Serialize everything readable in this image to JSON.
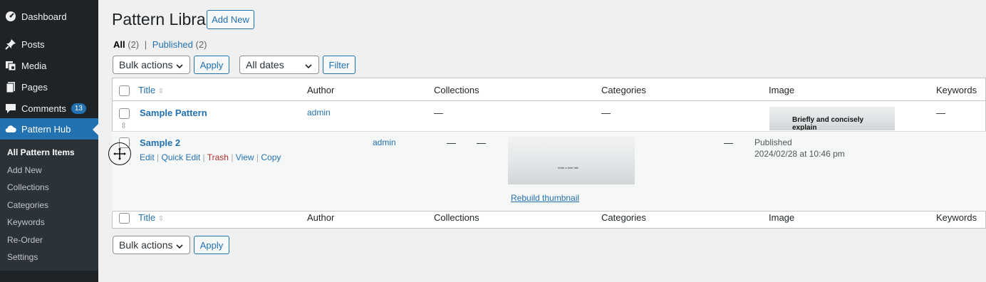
{
  "sidebar": {
    "dashboard": "Dashboard",
    "posts": "Posts",
    "media": "Media",
    "pages": "Pages",
    "comments": "Comments",
    "comments_count": "13",
    "pattern_hub": "Pattern Hub",
    "submenu": [
      "All Pattern Items",
      "Add New",
      "Collections",
      "Categories",
      "Keywords",
      "Re-Order",
      "Settings"
    ]
  },
  "header": {
    "title": "Pattern Library",
    "add_new": "Add New"
  },
  "views": {
    "all_label": "All",
    "all_count": "(2)",
    "sep": "|",
    "published_label": "Published",
    "published_count": "(2)"
  },
  "toolbar": {
    "bulk_actions": "Bulk actions",
    "apply": "Apply",
    "dates": "All dates",
    "filter": "Filter"
  },
  "table": {
    "columns": {
      "title": "Title",
      "author": "Author",
      "collections": "Collections",
      "categories": "Categories",
      "image": "Image",
      "keywords": "Keywords"
    },
    "rows": [
      {
        "title": "Sample Pattern",
        "author": "admin",
        "collections": "—",
        "categories": "—",
        "keywords": "—",
        "thumb_text": "Briefly and concisely explain"
      },
      {
        "title": "Sample 2",
        "author": "admin",
        "collections": "—",
        "categories": "—",
        "keywords": "—",
        "status": "Published",
        "date": "2024/02/28 at 10:46 pm",
        "actions": [
          "Edit",
          "Quick Edit",
          "Trash",
          "View",
          "Copy"
        ],
        "thumb_text": "Write a brief title",
        "rebuild": "Rebuild thumbnail"
      }
    ]
  },
  "bottom_toolbar": {
    "bulk_actions": "Bulk actions",
    "apply": "Apply"
  }
}
